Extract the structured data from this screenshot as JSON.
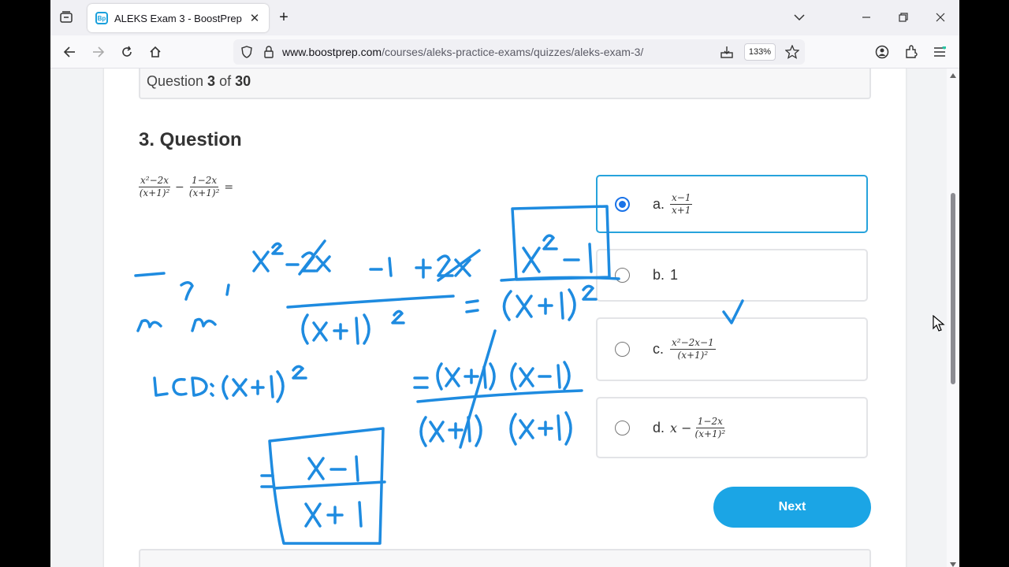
{
  "browser": {
    "tab_title": "ALEKS Exam 3 - BoostPrep",
    "favicon_text": "Bp",
    "url_domain": "www.boostprep.com",
    "url_path": "/courses/aleks-practice-exams/quizzes/aleks-exam-3/",
    "zoom_level": "133%"
  },
  "quiz": {
    "counter_prefix": "Question ",
    "current": "3",
    "counter_mid": " of ",
    "total": "30",
    "question_title": "3. Question",
    "expression": {
      "term1_num": "x²−2x",
      "term1_den": "(x+1)²",
      "operator": "−",
      "term2_num": "1−2x",
      "term2_den": "(x+1)²",
      "equals": "="
    },
    "answers": [
      {
        "letter": "a.",
        "num": "x−1",
        "den": "x+1",
        "selected": true
      },
      {
        "letter": "b.",
        "text": "1",
        "selected": false
      },
      {
        "letter": "c.",
        "num": "x²−2x−1",
        "den": "(x+1)²",
        "selected": false
      },
      {
        "letter": "d.",
        "prefix": "x −",
        "num": "1−2x",
        "den": "(x+1)²",
        "selected": false
      }
    ],
    "next_label": "Next"
  },
  "colors": {
    "ink": "#1e8be0",
    "accent": "#1ba5e5",
    "selected_border": "#27a3dc"
  },
  "handwriting": {
    "crossed_terms": [
      "x² − 2x",
      "−1 + 2x"
    ],
    "combined_fraction": "(x² − 1) / (x+1)²",
    "lcd_note": "LCD: (x+1)²",
    "factored": "= (x+1)(x−1) / (x+1)(x+1)",
    "boxed_result": "= (x−1) / (x+1)"
  }
}
